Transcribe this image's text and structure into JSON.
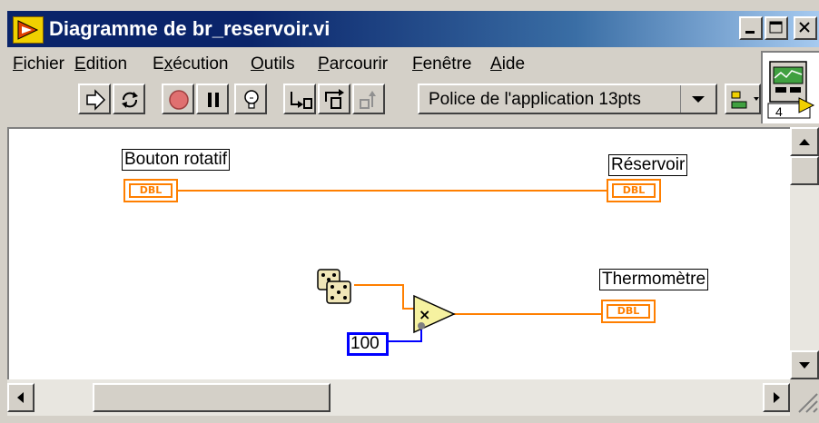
{
  "window": {
    "title": "Diagramme de br_reservoir.vi",
    "buttons": [
      "minimize",
      "maximize",
      "close"
    ]
  },
  "menu": {
    "items": [
      {
        "label_ul": "F",
        "label_rest": "ichier"
      },
      {
        "label_ul": "E",
        "label_rest": "dition"
      },
      {
        "label_pre": "E",
        "label_ul": "x",
        "label_rest": "écution"
      },
      {
        "label_ul": "O",
        "label_rest": "utils"
      },
      {
        "label_ul": "P",
        "label_rest": "arcourir"
      },
      {
        "label_ul": "F",
        "label_rest": "enêtre"
      },
      {
        "label_ul": "A",
        "label_rest": "ide"
      }
    ]
  },
  "toolbar": {
    "font_select": "Police de l'application 13pts",
    "icons": [
      "run-icon",
      "run-continuously-icon",
      "abort-icon",
      "pause-icon",
      "highlight-execution-icon",
      "step-into-icon",
      "step-over-icon",
      "step-out-icon",
      "align-icon"
    ]
  },
  "icon_pane": {
    "badge": "4"
  },
  "diagram": {
    "nodes": {
      "knob": {
        "label": "Bouton rotatif",
        "type": "DBL"
      },
      "tank": {
        "label": "Réservoir",
        "type": "DBL"
      },
      "thermo": {
        "label": "Thermomètre",
        "type": "DBL"
      },
      "constant": {
        "value": "100"
      },
      "multiply": {
        "symbol": "×"
      },
      "random": {
        "icon": "dice-icon"
      }
    },
    "wire_color": "#ff7f00",
    "const_wire_color": "#0000ff"
  },
  "colors": {
    "titlebar_start": "#0a246a",
    "titlebar_end": "#a6caf0",
    "dbl_orange": "#ff7f00",
    "const_blue": "#0000ff"
  }
}
